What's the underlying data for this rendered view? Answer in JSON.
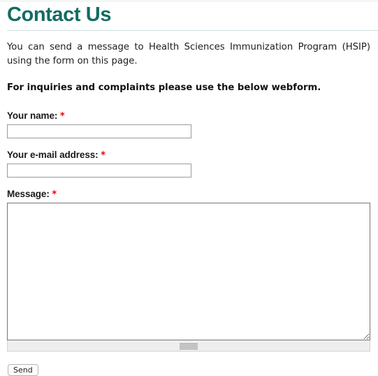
{
  "page": {
    "title": "Contact Us",
    "title_color": "#136c62",
    "intro_paragraph": "You can send a message to Health Sciences Immunization Program (HSIP) using the form on this page.",
    "emphasis_paragraph": "For inquiries and complaints please use the below webform."
  },
  "form": {
    "required_marker": "*",
    "fields": [
      {
        "name": "your-name",
        "label": "Your name:",
        "required": true,
        "type": "text",
        "value": "",
        "placeholder": ""
      },
      {
        "name": "your-email-address",
        "label": "Your e-mail address:",
        "required": true,
        "type": "text",
        "value": "",
        "placeholder": ""
      },
      {
        "name": "message",
        "label": "Message:",
        "required": true,
        "type": "textarea",
        "value": "",
        "placeholder": ""
      }
    ],
    "submit_label": "Send",
    "grippie_icon": "resize-grippie-icon",
    "resize_handle_icon": "resize-handle-icon"
  },
  "colors": {
    "heading_teal": "#136c62",
    "required_red": "#ee0000",
    "rule_gray": "#cfdde0",
    "input_border": "#9a9a9a",
    "textarea_border": "#767676",
    "grippie_background": "#eeeeee"
  }
}
